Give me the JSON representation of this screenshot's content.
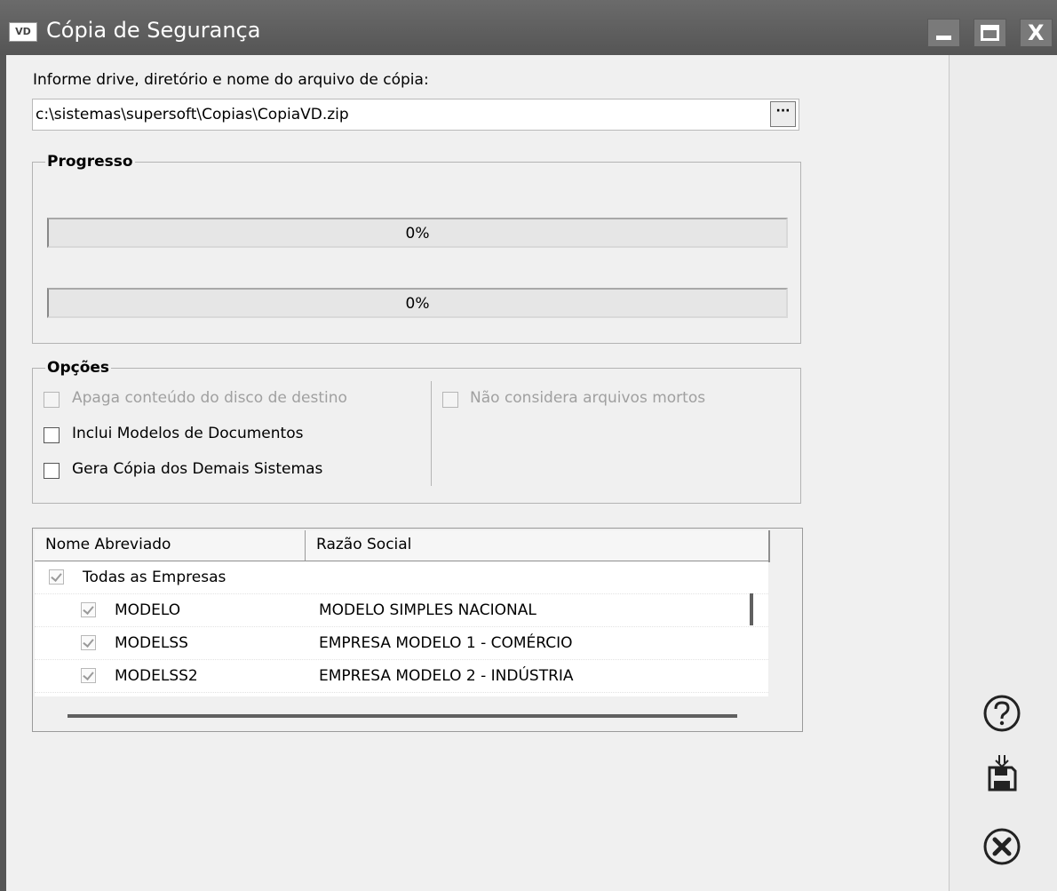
{
  "window": {
    "title": "Cópia de Segurança",
    "logo_text": "VD",
    "minimize_icon": "minimize-icon",
    "maximize_icon": "maximize-icon",
    "close_icon": "close-icon",
    "close_glyph": "X"
  },
  "form": {
    "path_label": "Informe drive, diretório e nome do arquivo de cópia:",
    "path_value": "c:\\sistemas\\supersoft\\Copias\\CopiaVD.zip",
    "browse_label": "···"
  },
  "progress": {
    "title": "Progresso",
    "bars": [
      {
        "percent": 0,
        "text": "0%"
      },
      {
        "percent": 0,
        "text": "0%"
      }
    ]
  },
  "options": {
    "title": "Opções",
    "items": [
      {
        "label": "Apaga conteúdo do disco de destino",
        "checked": false,
        "enabled": false
      },
      {
        "label": "Inclui Modelos de Documentos",
        "checked": false,
        "enabled": true
      },
      {
        "label": "Gera Cópia dos Demais Sistemas",
        "checked": false,
        "enabled": true
      },
      {
        "label": "Não considera arquivos mortos",
        "checked": false,
        "enabled": false
      }
    ]
  },
  "grid": {
    "columns": [
      "Nome Abreviado",
      "Razão Social"
    ],
    "rows": [
      {
        "name": "Todas as Empresas",
        "razao": "",
        "checked": true
      },
      {
        "name": "MODELO",
        "razao": "MODELO SIMPLES NACIONAL",
        "checked": true
      },
      {
        "name": "MODELSS",
        "razao": "EMPRESA MODELO 1 - COMÉRCIO",
        "checked": true
      },
      {
        "name": "MODELSS2",
        "razao": "EMPRESA MODELO 2 - INDÚSTRIA",
        "checked": true
      }
    ]
  },
  "sidebar": {
    "buttons": [
      {
        "icon": "help-icon"
      },
      {
        "icon": "save-icon"
      },
      {
        "icon": "cancel-icon"
      }
    ]
  },
  "colors": {
    "titlebar": "#555555",
    "progress_fill": "#3aa34a"
  }
}
